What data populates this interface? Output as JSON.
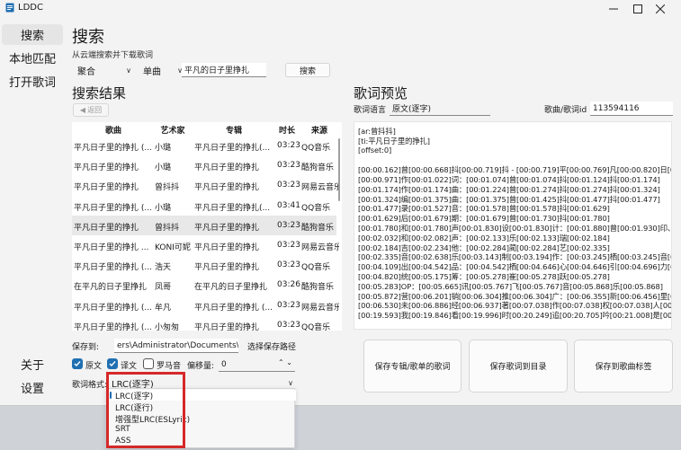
{
  "app": {
    "title": "LDDC"
  },
  "nav": {
    "items": [
      "搜索",
      "本地匹配",
      "打开歌词"
    ],
    "bottom": [
      "关于",
      "设置"
    ]
  },
  "search": {
    "title": "搜索",
    "hint": "从云端搜索并下载歌词",
    "source": "聚合",
    "type": "单曲",
    "query": "平凡的日子里挣扎",
    "button": "搜索"
  },
  "results": {
    "title": "搜索结果",
    "back": "返回",
    "columns": [
      "歌曲",
      "艺术家",
      "专辑",
      "时长",
      "来源"
    ],
    "rows": [
      [
        "平凡日子里的挣扎 (...",
        "小璐",
        "平凡日子里的挣扎(...",
        "03:23",
        "QQ音乐"
      ],
      [
        "平凡日子里的挣扎",
        "小璐",
        "平凡日子里的挣扎",
        "03:23",
        "酷狗音乐"
      ],
      [
        "平凡日子里的挣扎",
        "曾抖抖",
        "平凡日子里的挣扎",
        "03:23",
        "网易云音乐"
      ],
      [
        "平凡日子里的挣扎 (...",
        "小璐",
        "平凡日子里的挣扎(...",
        "03:41",
        "QQ音乐"
      ],
      [
        "平凡日子里的挣扎",
        "曾抖抖",
        "平凡日子里的挣扎",
        "03:23",
        "酷狗音乐"
      ],
      [
        "平凡日子里的挣扎 ...",
        "KONI可妮",
        "平凡日子里的挣扎",
        "03:23",
        "网易云音乐"
      ],
      [
        "平凡日子里的挣扎 (...",
        "浩天",
        "平凡日子里的挣扎",
        "03:23",
        "QQ音乐"
      ],
      [
        "在平凡的日子里挣扎",
        "凤哥",
        "在平凡的日子里挣扎",
        "03:26",
        "酷狗音乐"
      ],
      [
        "平凡日子里的挣扎 (...",
        "牟凡",
        "平凡日子里的挣扎 (...",
        "03:23",
        "网易云音乐"
      ],
      [
        "平凡日子里的挣扎 (...",
        "小匆匆",
        "平凡日子里的挣扎",
        "03:23",
        "QQ音乐"
      ]
    ]
  },
  "save": {
    "label": "保存到:",
    "path": "ers\\Administrator\\Documents\\Lyrics",
    "choose": "选择保存路径",
    "options": [
      "原文",
      "译文",
      "罗马音"
    ],
    "offset_label": "偏移量:",
    "offset_value": "0",
    "format_label": "歌词格式:",
    "format_value": "LRC(逐字)",
    "formats": [
      "LRC(逐字)",
      "LRC(逐行)",
      "增强型LRC(ESLyric)",
      "SRT",
      "ASS"
    ]
  },
  "preview": {
    "title": "歌词预览",
    "lang_label": "歌词语言",
    "lang_value": "原文(逐字)",
    "id_label": "歌曲/歌词id",
    "id_value": "113594116",
    "lines": [
      "[ar:曾抖抖]",
      "[ti:平凡日子里的挣扎]",
      "[offset:0]",
      "",
      "[00:00.162]曾[00:00.668]抖[00:00.719]抖 - [00:00.719]平[00:00.769]凡[00:00.820]日[00",
      "[00:00.971]作[00:01.022]词：[00:01.074]曾[00:01.074]抖[00:01.124]抖[00:01.174]",
      "[00:01.174]作[00:01.174]曲：[00:01.224]曾[00:01.274]抖[00:01.274]抖[00:01.324]",
      "[00:01.324]编[00:01.375]曲：[00:01.375]曾[00:01.425]抖[00:01.477]抖[00:01.477]",
      "[00:01.477]录[00:01.527]音：[00:01.578]曾[00:01.578]抖[00:01.629]",
      "[00:01.629]后[00:01.679]期：[00:01.679]曾[00:01.730]抖[00:01.780]",
      "[00:01.780]和[00:01.780]声[00:01.830]设[00:01.830]计：[00:01.880]曾[00:01.930]印、[",
      "[00:02.032]和[00:02.082]声：[00:02.133]乐[00:02.133]瑞[00:02.184]",
      "[00:02.184]吉[00:02.234]他：[00:02.284]蔺[00:02.284]艺[00:02.335]",
      "[00:02.335]音[00:02.638]乐[00:03.143]制[00:03.194]作：[00:03.245]栖[00:03.245]音[00:",
      "[00:04.109]出[00:04.542]品：[00:04.542]栖[00:04.646]心[00:04.646]引[00:04.696]力[00",
      "[00:04.820]统[00:05.175]筹：[00:05.278]崔[00:05.278]跃[00:05.278]",
      "[00:05.283]OP：[00:05.665]讯[00:05.767]飞[00:05.767]音[00:05.868]乐[00:05.868]",
      "[00:05.872]营[00:06.201]销[00:06.304]推[00:06.304]广：[00:06.355]新[00:06.456]里[00",
      "[00:06.530]未[00:06.886]经[00:06.937]著[00:07.038]作[00:07.038]权[00:07.038]人[00:0",
      "[00:19.593]我[00:19.846]看[00:19.996]时[00:20.249]追[00:20.705]吟[00:21.008]是[00:2"
    ]
  },
  "actions": [
    "保存专辑/歌单的歌词",
    "保存歌词到目录",
    "保存到歌曲标签"
  ],
  "colors": {
    "accent": "#1f6fb2",
    "highlight": "#d62828",
    "background": "#f3f3f3"
  }
}
